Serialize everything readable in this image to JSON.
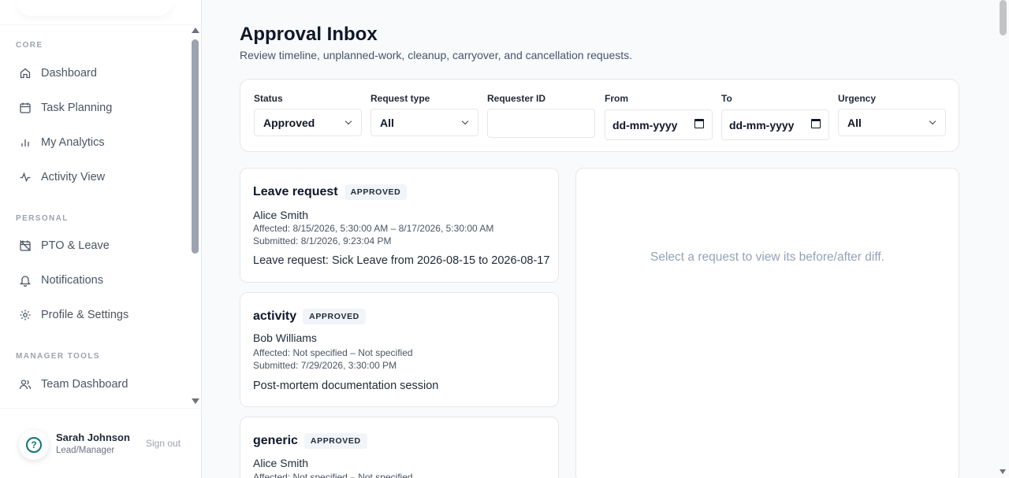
{
  "sidebar": {
    "sections": [
      {
        "label": "CORE"
      },
      {
        "label": "PERSONAL"
      },
      {
        "label": "MANAGER TOOLS"
      }
    ],
    "items": [
      {
        "label": "Dashboard",
        "icon": "home-icon"
      },
      {
        "label": "Task Planning",
        "icon": "calendar-icon"
      },
      {
        "label": "My Analytics",
        "icon": "bar-chart-icon"
      },
      {
        "label": "Activity View",
        "icon": "activity-icon"
      },
      {
        "label": "PTO & Leave",
        "icon": "calendar-off-icon"
      },
      {
        "label": "Notifications",
        "icon": "bell-icon"
      },
      {
        "label": "Profile & Settings",
        "icon": "gear-icon"
      },
      {
        "label": "Team Dashboard",
        "icon": "users-icon"
      }
    ],
    "user": {
      "help_glyph": "?",
      "name": "Sarah Johnson",
      "role": "Lead/Manager",
      "sign_out": "Sign out"
    }
  },
  "header": {
    "title": "Approval Inbox",
    "subtitle": "Review timeline, unplanned-work, cleanup, carryover, and cancellation requests."
  },
  "filters": {
    "status": {
      "label": "Status",
      "value": "Approved"
    },
    "request_type": {
      "label": "Request type",
      "value": "All"
    },
    "requester_id": {
      "label": "Requester ID",
      "value": ""
    },
    "from": {
      "label": "From",
      "placeholder": "dd-mm-yyyy"
    },
    "to": {
      "label": "To",
      "placeholder": "dd-mm-yyyy"
    },
    "urgency": {
      "label": "Urgency",
      "value": "All"
    }
  },
  "requests": [
    {
      "title": "Leave request",
      "status": "APPROVED",
      "requester": "Alice Smith",
      "affected": "Affected: 8/15/2026, 5:30:00 AM – 8/17/2026, 5:30:00 AM",
      "submitted": "Submitted: 8/1/2026, 9:23:04 PM",
      "description": "Leave request: Sick Leave from 2026-08-15 to 2026-08-17"
    },
    {
      "title": "activity",
      "status": "APPROVED",
      "requester": "Bob Williams",
      "affected": "Affected: Not specified – Not specified",
      "submitted": "Submitted: 7/29/2026, 3:30:00 PM",
      "description": "Post-mortem documentation session"
    },
    {
      "title": "generic",
      "status": "APPROVED",
      "requester": "Alice Smith",
      "affected": "Affected: Not specified – Not specified",
      "submitted": "",
      "description": ""
    }
  ],
  "detail": {
    "empty_message": "Select a request to view its before/after diff."
  },
  "colors": {
    "accent": "#0f766e",
    "badge_bg": "#f1f5f9",
    "muted_text": "#94a3b8"
  }
}
